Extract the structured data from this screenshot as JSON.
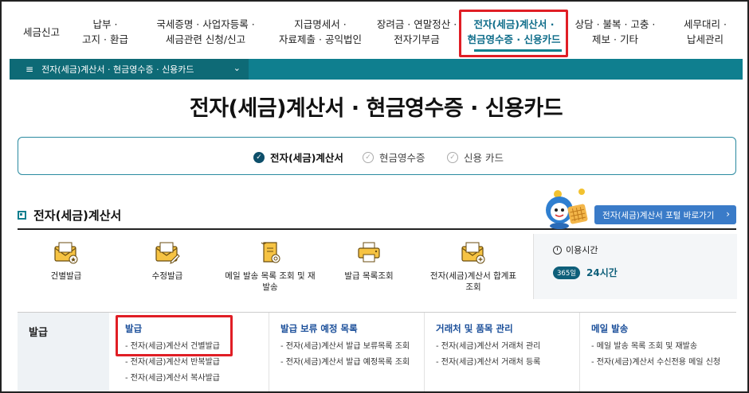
{
  "top_nav": {
    "items": [
      {
        "line1": "세금신고",
        "line2": ""
      },
      {
        "line1": "납부 ·",
        "line2": "고지 · 환급"
      },
      {
        "line1": "국세증명 · 사업자등록 ·",
        "line2": "세금관련 신청/신고"
      },
      {
        "line1": "지급명세서 ·",
        "line2": "자료제출 · 공익법인"
      },
      {
        "line1": "장려금 · 연말정산 ·",
        "line2": "전자기부금"
      },
      {
        "line1": "전자(세금)계산서 ·",
        "line2": "현금영수증 · 신용카드"
      },
      {
        "line1": "상담 · 불복 · 고충 ·",
        "line2": "제보 · 기타"
      },
      {
        "line1": "세무대리 ·",
        "line2": "납세관리"
      }
    ]
  },
  "breadcrumb": {
    "menu_icon": "≡",
    "label": "전자(세금)계산서 · 현금영수증 · 신용카드",
    "chevron": "⌄"
  },
  "page_title": "전자(세금)계산서 · 현금영수증 · 신용카드",
  "tabs": [
    {
      "label": "전자(세금)계산서",
      "check": "✓"
    },
    {
      "label": "현금영수증",
      "check": "✓"
    },
    {
      "label": "신용 카드",
      "check": "✓"
    }
  ],
  "section": {
    "title": "전자(세금)계산서",
    "portal_button": "전자(세금)계산서 포털 바로가기",
    "portal_arrow": "›"
  },
  "quick_links": [
    {
      "label": "건별발급",
      "icon": "envelope-star-icon"
    },
    {
      "label": "수정발급",
      "icon": "envelope-edit-icon"
    },
    {
      "label": "메일 발송 목록 조회 및 재발송",
      "icon": "mail-list-icon"
    },
    {
      "label": "발급 목록조회",
      "icon": "printer-icon"
    },
    {
      "label": "전자(세금)계산서 합계표 조회",
      "icon": "envelope-plus-icon"
    }
  ],
  "usage_time": {
    "title": "이용시간",
    "badge": "365일",
    "value": "24시간"
  },
  "menu": {
    "left_label": "발급",
    "columns": [
      {
        "title": "발급",
        "items": [
          "- 전자(세금)계산서 건별발급",
          "- 전자(세금)계산서 반복발급",
          "- 전자(세금)계산서 복사발급"
        ]
      },
      {
        "title": "발급 보류 예정 목록",
        "items": [
          "- 전자(세금)계산서 발급 보류목록 조회",
          "- 전자(세금)계산서 발급 예정목록 조회"
        ]
      },
      {
        "title": "거래처 및 품목 관리",
        "items": [
          "- 전자(세금)계산서 거래처 관리",
          "- 전자(세금)계산서 거래처 등록"
        ]
      },
      {
        "title": "메일 발송",
        "items": [
          "- 메일 발송 목록 조회 및 재발송",
          "- 전자(세금)계산서 수신전용 메일 신청"
        ]
      }
    ]
  },
  "colors": {
    "teal": "#0f7f8f",
    "highlight_red": "#e01e25",
    "portal_blue": "#3a7bc8",
    "menu_title_blue": "#1b4f9a"
  }
}
